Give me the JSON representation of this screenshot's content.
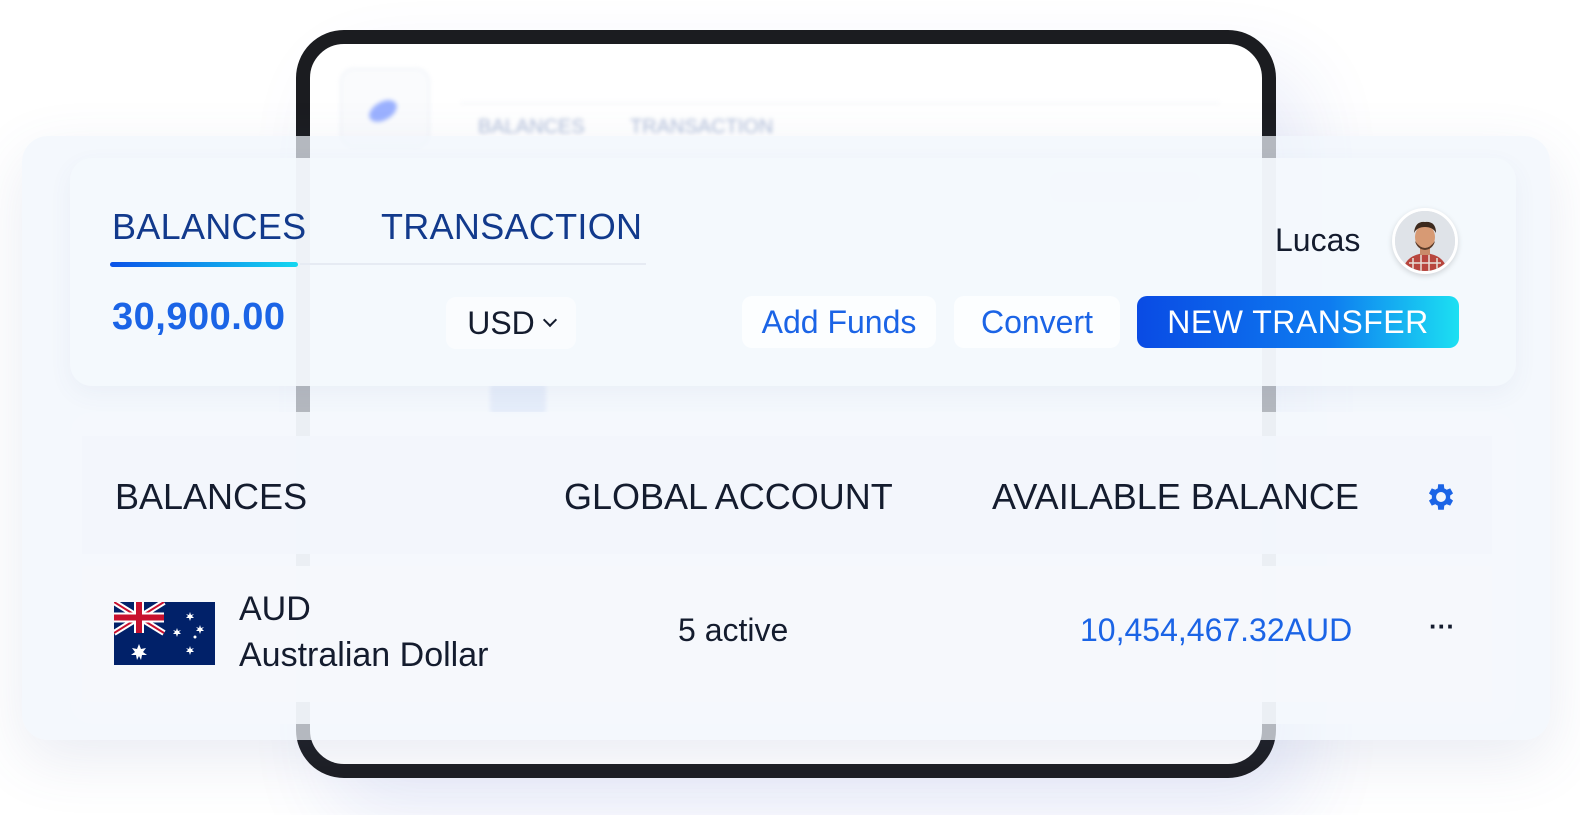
{
  "header": {
    "tabs": [
      {
        "label": "BALANCES",
        "active": true
      },
      {
        "label": "TRANSACTION",
        "active": false
      }
    ],
    "total_balance": "30,900.00",
    "currency": "USD",
    "add_funds_label": "Add Funds",
    "convert_label": "Convert",
    "new_transfer_label": "NEW TRANSFER",
    "user_name": "Lucas"
  },
  "table": {
    "columns": [
      "BALANCES",
      "GLOBAL ACCOUNT",
      "AVAILABLE BALANCE"
    ],
    "rows": [
      {
        "flag": "australia-flag-icon",
        "code": "AUD",
        "name": "Australian Dollar",
        "global_account": "5 active",
        "available_balance": "10,454,467.32AUD"
      }
    ]
  },
  "colors": {
    "accent": "#1b64e6",
    "tab_text": "#123a8c",
    "gradient_start": "#0a4be4",
    "gradient_end": "#1ce0f2",
    "device_frame": "#1b1c20"
  },
  "icons": [
    "logo-icon",
    "chevron-down-icon",
    "avatar",
    "gear-icon",
    "australia-flag-icon",
    "more-icon"
  ]
}
